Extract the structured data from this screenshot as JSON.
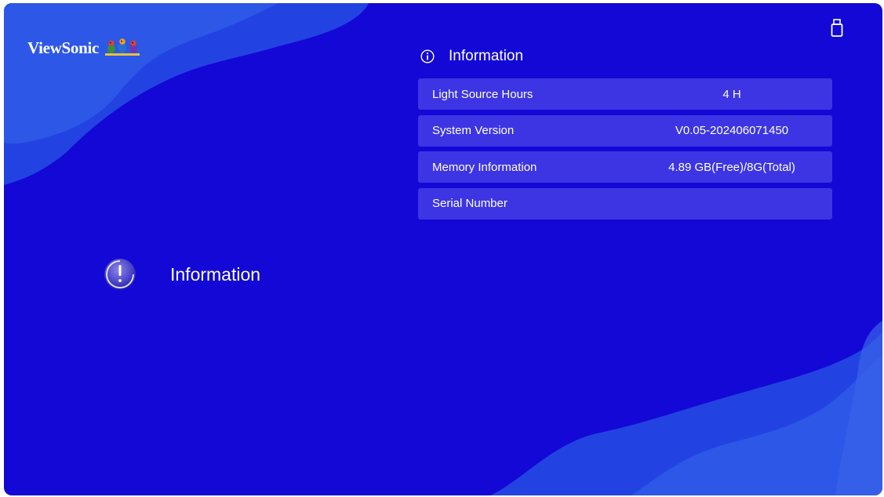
{
  "brand": {
    "logo_text": "ViewSonic"
  },
  "status_bar": {
    "usb_icon": "usb-drive-icon"
  },
  "left_menu": {
    "selected_item": {
      "label": "Information",
      "icon": "info-exclamation-icon"
    }
  },
  "panel": {
    "title": "Information",
    "title_icon": "info-circle-icon",
    "rows": [
      {
        "label": "Light Source Hours",
        "value": "4 H"
      },
      {
        "label": "System Version",
        "value": "V0.05-202406071450"
      },
      {
        "label": "Memory Information",
        "value": "4.89 GB(Free)/8G(Total)"
      },
      {
        "label": "Serial Number",
        "value": ""
      }
    ]
  },
  "colors": {
    "background": "#1308d6",
    "wave_light": "#2e5ae8",
    "wave_mid": "#2243e2",
    "row_background": "#3d35e3",
    "text": "#ffffff"
  }
}
